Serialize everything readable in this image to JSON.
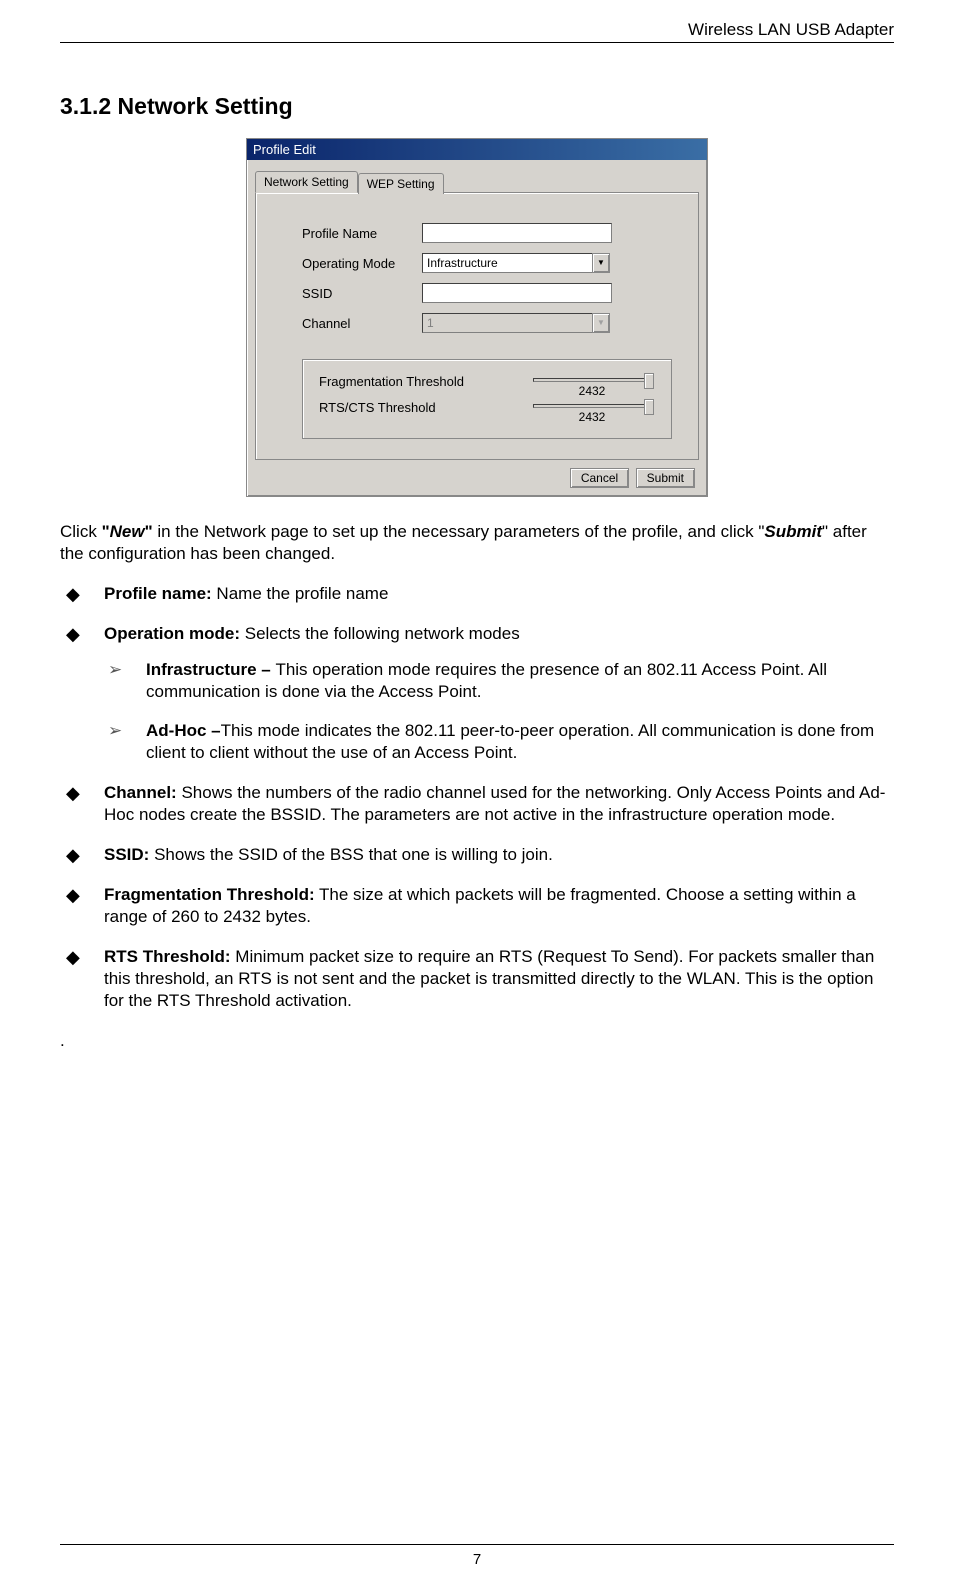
{
  "header": {
    "product_name": "Wireless LAN USB Adapter"
  },
  "section": {
    "number_title": "3.1.2 Network Setting"
  },
  "dialog": {
    "title": "Profile Edit",
    "tabs": {
      "active": "Network Setting",
      "inactive": "WEP Setting"
    },
    "fields": {
      "profile_name_label": "Profile Name",
      "profile_name_value": "",
      "operating_mode_label": "Operating Mode",
      "operating_mode_value": "Infrastructure",
      "ssid_label": "SSID",
      "ssid_value": "",
      "channel_label": "Channel",
      "channel_value": "1"
    },
    "thresholds": {
      "frag_label": "Fragmentation Threshold",
      "frag_value": "2432",
      "rts_label": "RTS/CTS Threshold",
      "rts_value": "2432"
    },
    "buttons": {
      "cancel": "Cancel",
      "submit": "Submit"
    }
  },
  "intro": {
    "pre": "Click ",
    "new_quote_open": "\"",
    "new_word": "New",
    "new_quote_close": "\"",
    "mid": " in the Network page to set up the necessary parameters of the profile, and click \"",
    "submit_word": "Submit",
    "post": "\" after the configuration has been changed."
  },
  "bullets": {
    "profile_name": {
      "label": "Profile name:",
      "text": " Name the profile name"
    },
    "operation_mode": {
      "label": "Operation mode:",
      "text": " Selects the following network modes"
    },
    "infra": {
      "label": "Infrastructure – ",
      "text": "This operation mode requires the presence of an 802.11 Access Point. All communication is done via the Access Point."
    },
    "adhoc": {
      "label": "Ad-Hoc –",
      "text": "This mode indicates the 802.11 peer-to-peer operation. All communication is done from client to client without the use of an Access Point."
    },
    "channel": {
      "label": "Channel:",
      "text": " Shows the numbers of the radio channel used for the networking. Only Access Points and Ad-Hoc nodes create the BSSID. The parameters are not active in the infrastructure operation mode."
    },
    "ssid": {
      "label": "SSID:",
      "text": " Shows the SSID of the BSS that one is willing to join."
    },
    "frag": {
      "label": "Fragmentation Threshold:",
      "text": " The size at which packets will be fragmented. Choose a setting within a range of 260 to 2432 bytes."
    },
    "rts": {
      "label": "RTS Threshold:",
      "text": " Minimum packet size to require an RTS (Request To Send). For packets smaller than this threshold, an RTS is not sent and the packet is transmitted directly to the WLAN. This is the option for the RTS Threshold activation."
    }
  },
  "trailing_dot": ".",
  "page_number": "7"
}
